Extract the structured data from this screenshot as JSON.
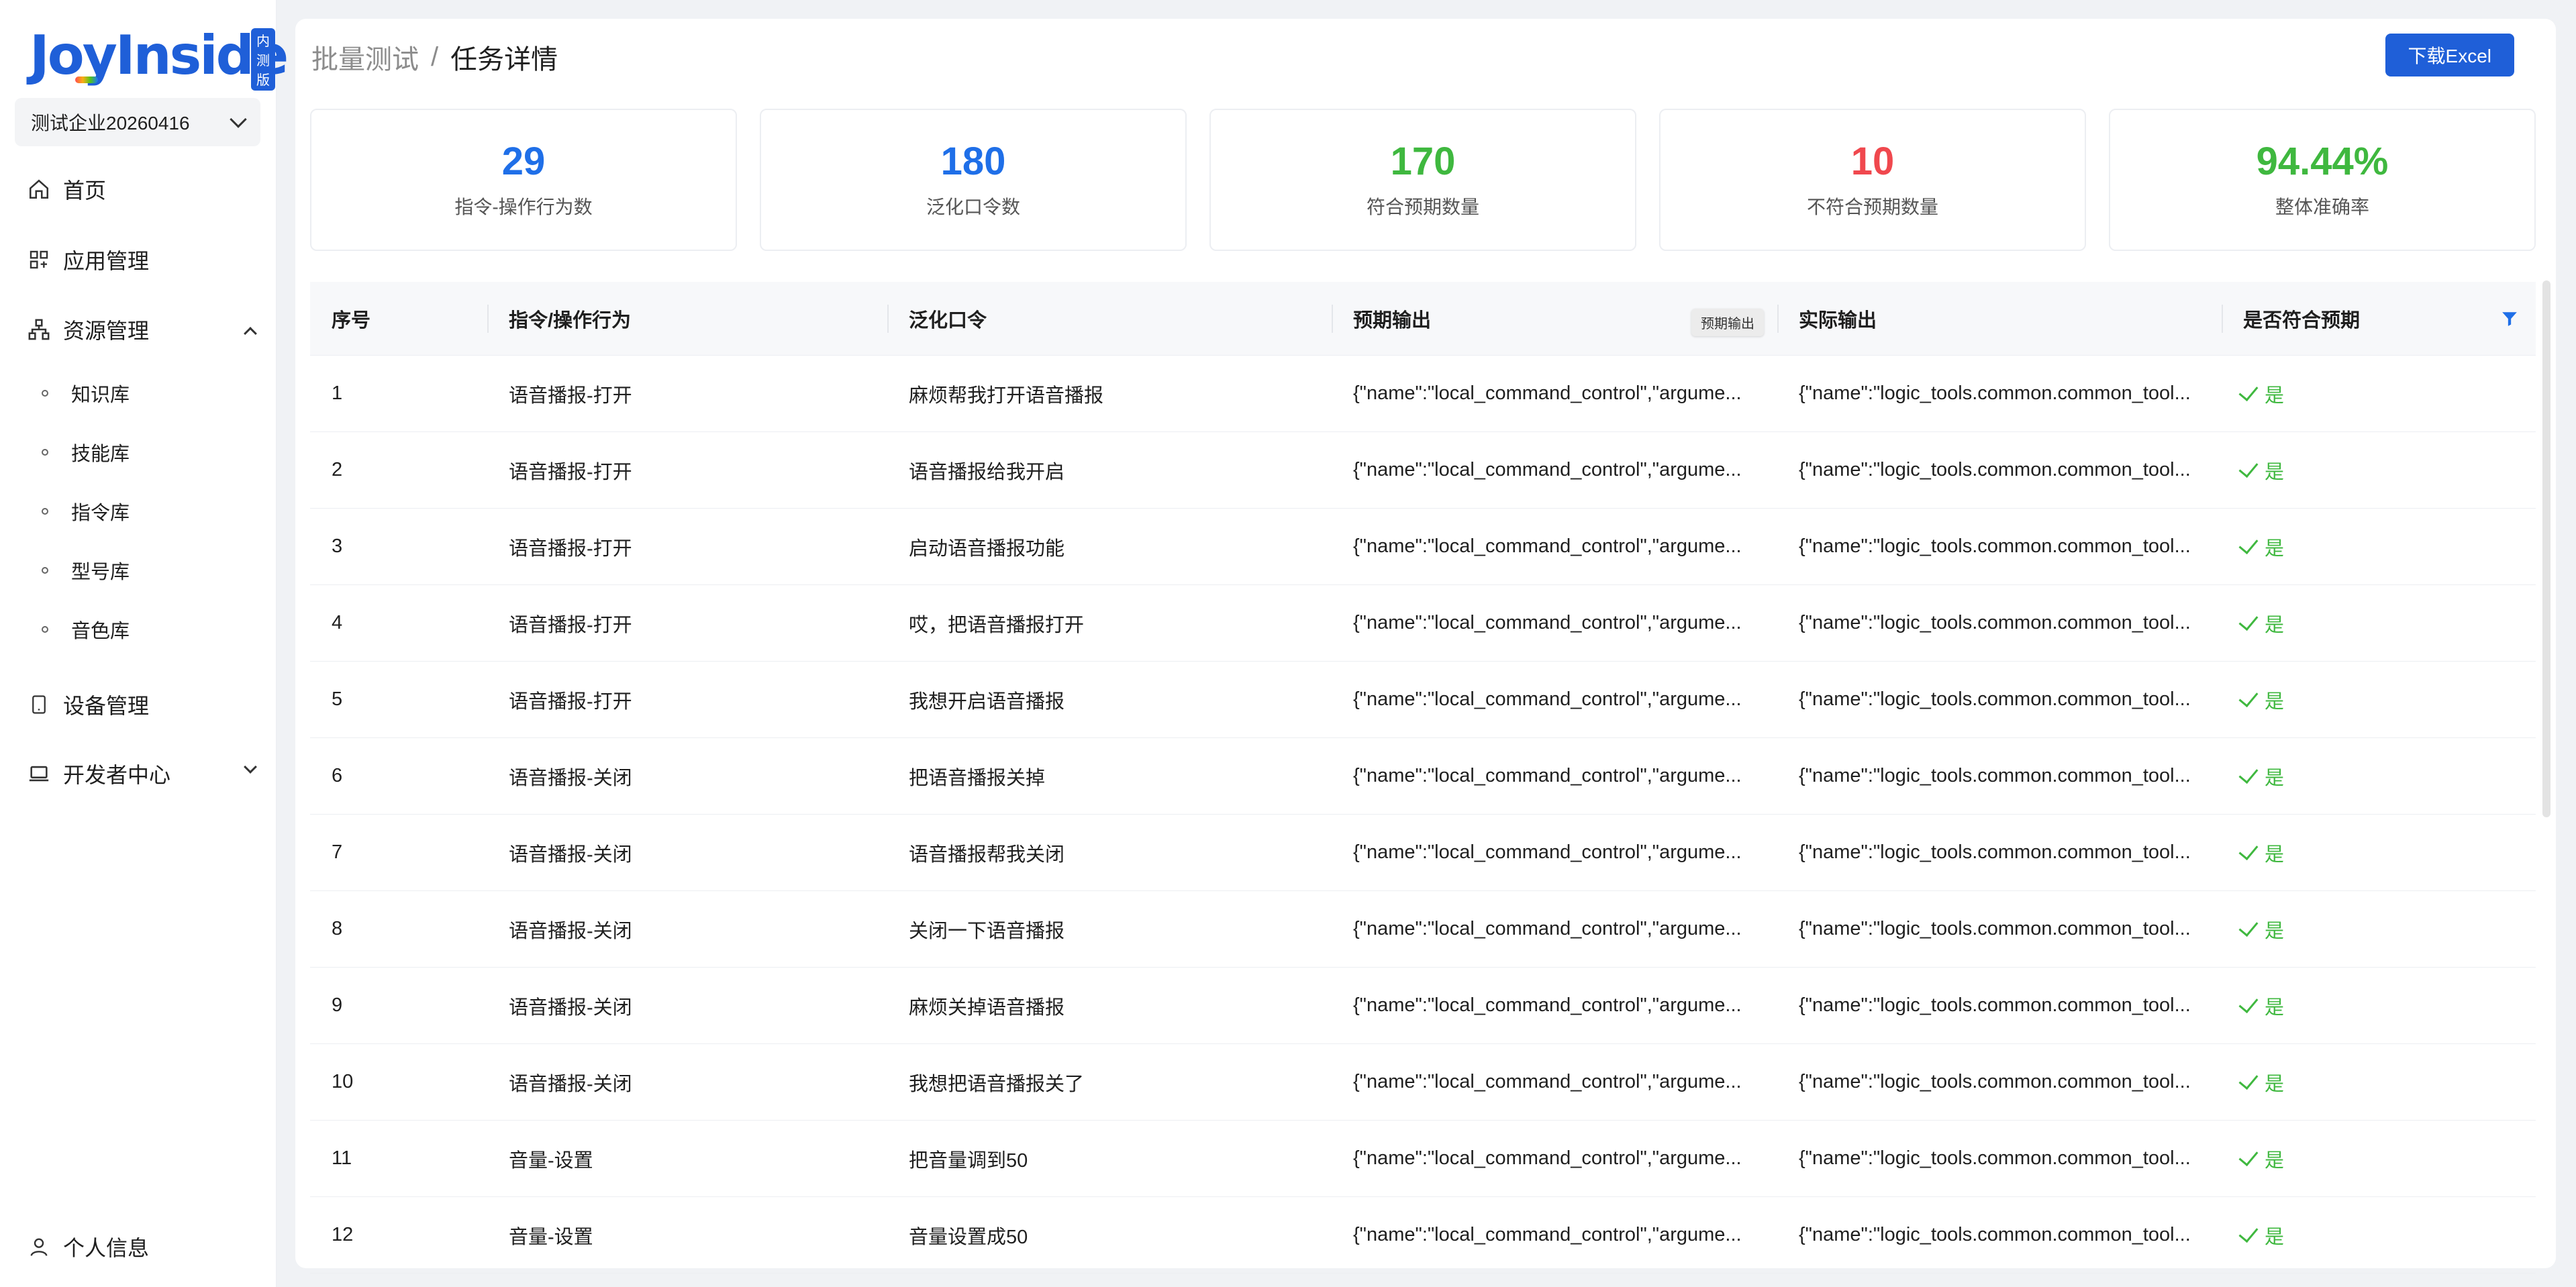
{
  "app": {
    "logo_text": "JoyInside",
    "beta_badge": "内测版",
    "enterprise": "测试企业20260416"
  },
  "nav": {
    "home": "首页",
    "app_mgmt": "应用管理",
    "resource_mgmt": "资源管理",
    "resource_sub": [
      "知识库",
      "技能库",
      "指令库",
      "型号库",
      "音色库"
    ],
    "device_mgmt": "设备管理",
    "dev_center": "开发者中心",
    "profile": "个人信息"
  },
  "breadcrumb": {
    "parent": "批量测试",
    "separator": "/",
    "current": "任务详情"
  },
  "toolbar": {
    "download_label": "下载Excel"
  },
  "stats": [
    {
      "value": "29",
      "label": "指令-操作行为数",
      "color": "#1f6fe8"
    },
    {
      "value": "180",
      "label": "泛化口令数",
      "color": "#1f6fe8"
    },
    {
      "value": "170",
      "label": "符合预期数量",
      "color": "#3fb83f"
    },
    {
      "value": "10",
      "label": "不符合预期数量",
      "color": "#f0484e"
    },
    {
      "value": "94.44%",
      "label": "整体准确率",
      "color": "#3fb83f"
    }
  ],
  "table": {
    "columns": [
      "序号",
      "指令/操作行为",
      "泛化口令",
      "预期输出",
      "实际输出",
      "是否符合预期"
    ],
    "tooltip": "预期输出",
    "rows": [
      {
        "idx": "1",
        "action": "语音播报-打开",
        "phrase": "麻烦帮我打开语音播报",
        "expected": "{\"name\":\"local_command_control\",\"argume...",
        "actual": "{\"name\":\"logic_tools.common.common_tool...",
        "match": "是"
      },
      {
        "idx": "2",
        "action": "语音播报-打开",
        "phrase": "语音播报给我开启",
        "expected": "{\"name\":\"local_command_control\",\"argume...",
        "actual": "{\"name\":\"logic_tools.common.common_tool...",
        "match": "是"
      },
      {
        "idx": "3",
        "action": "语音播报-打开",
        "phrase": "启动语音播报功能",
        "expected": "{\"name\":\"local_command_control\",\"argume...",
        "actual": "{\"name\":\"logic_tools.common.common_tool...",
        "match": "是"
      },
      {
        "idx": "4",
        "action": "语音播报-打开",
        "phrase": "哎，把语音播报打开",
        "expected": "{\"name\":\"local_command_control\",\"argume...",
        "actual": "{\"name\":\"logic_tools.common.common_tool...",
        "match": "是"
      },
      {
        "idx": "5",
        "action": "语音播报-打开",
        "phrase": "我想开启语音播报",
        "expected": "{\"name\":\"local_command_control\",\"argume...",
        "actual": "{\"name\":\"logic_tools.common.common_tool...",
        "match": "是"
      },
      {
        "idx": "6",
        "action": "语音播报-关闭",
        "phrase": "把语音播报关掉",
        "expected": "{\"name\":\"local_command_control\",\"argume...",
        "actual": "{\"name\":\"logic_tools.common.common_tool...",
        "match": "是"
      },
      {
        "idx": "7",
        "action": "语音播报-关闭",
        "phrase": "语音播报帮我关闭",
        "expected": "{\"name\":\"local_command_control\",\"argume...",
        "actual": "{\"name\":\"logic_tools.common.common_tool...",
        "match": "是"
      },
      {
        "idx": "8",
        "action": "语音播报-关闭",
        "phrase": "关闭一下语音播报",
        "expected": "{\"name\":\"local_command_control\",\"argume...",
        "actual": "{\"name\":\"logic_tools.common.common_tool...",
        "match": "是"
      },
      {
        "idx": "9",
        "action": "语音播报-关闭",
        "phrase": "麻烦关掉语音播报",
        "expected": "{\"name\":\"local_command_control\",\"argume...",
        "actual": "{\"name\":\"logic_tools.common.common_tool...",
        "match": "是"
      },
      {
        "idx": "10",
        "action": "语音播报-关闭",
        "phrase": "我想把语音播报关了",
        "expected": "{\"name\":\"local_command_control\",\"argume...",
        "actual": "{\"name\":\"logic_tools.common.common_tool...",
        "match": "是"
      },
      {
        "idx": "11",
        "action": "音量-设置",
        "phrase": "把音量调到50",
        "expected": "{\"name\":\"local_command_control\",\"argume...",
        "actual": "{\"name\":\"logic_tools.common.common_tool...",
        "match": "是"
      },
      {
        "idx": "12",
        "action": "音量-设置",
        "phrase": "音量设置成50",
        "expected": "{\"name\":\"local_command_control\",\"argume...",
        "actual": "{\"name\":\"logic_tools.common.common_tool...",
        "match": "是"
      }
    ]
  }
}
